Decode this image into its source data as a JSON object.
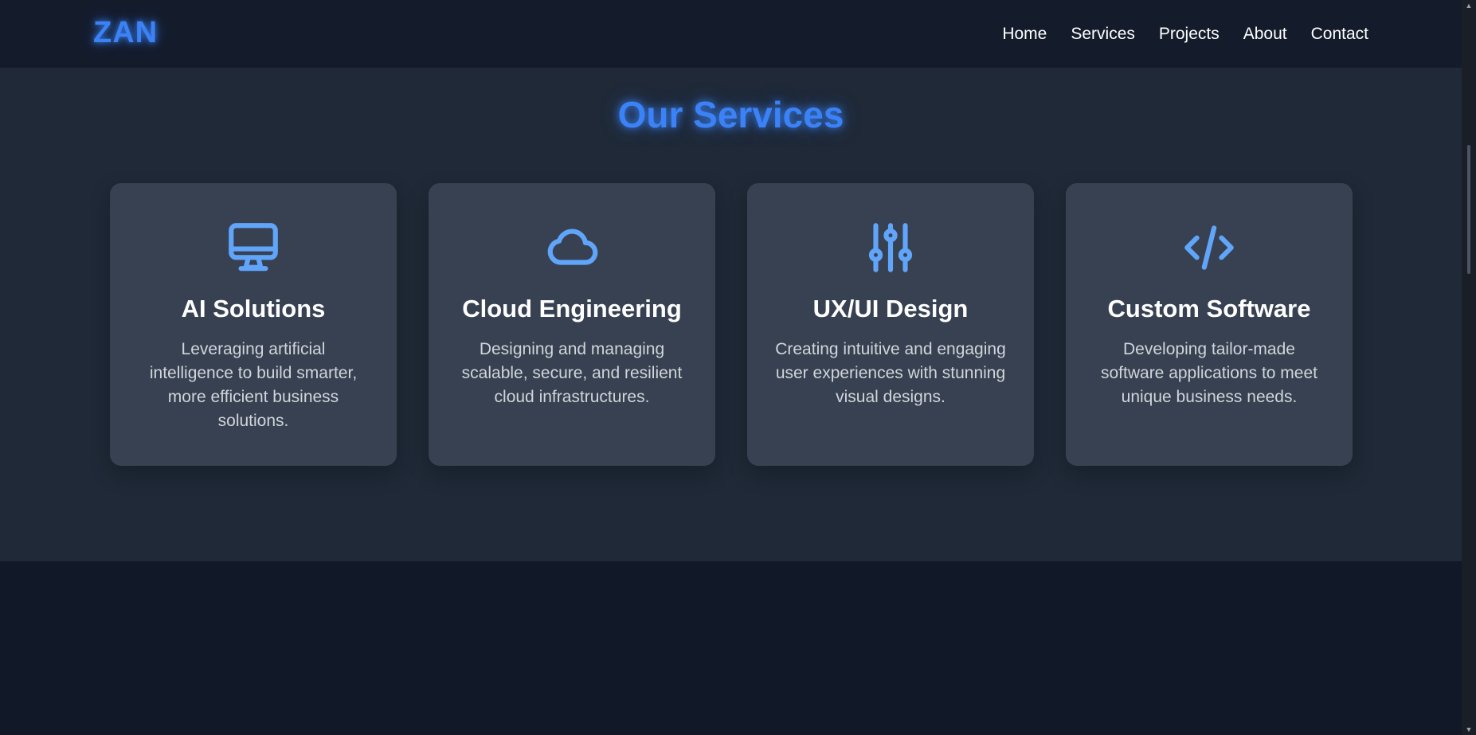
{
  "header": {
    "logo": "ZAN",
    "nav": [
      "Home",
      "Services",
      "Projects",
      "About",
      "Contact"
    ]
  },
  "services": {
    "title": "Our Services",
    "cards": [
      {
        "icon": "monitor-icon",
        "title": "AI Solutions",
        "description": "Leveraging artificial intelligence to build smarter, more efficient business solutions."
      },
      {
        "icon": "cloud-icon",
        "title": "Cloud Engineering",
        "description": "Designing and managing scalable, secure, and resilient cloud infrastructures."
      },
      {
        "icon": "sliders-icon",
        "title": "UX/UI Design",
        "description": "Creating intuitive and engaging user experiences with stunning visual designs."
      },
      {
        "icon": "code-icon",
        "title": "Custom Software",
        "description": "Developing tailor-made software applications to meet unique business needs."
      }
    ]
  },
  "colors": {
    "accent": "#3b82f6",
    "icon": "#60a5fa",
    "header_bg": "#141c2c",
    "section_bg": "#1f2937",
    "card_bg": "#374151",
    "page_bg": "#111827"
  }
}
